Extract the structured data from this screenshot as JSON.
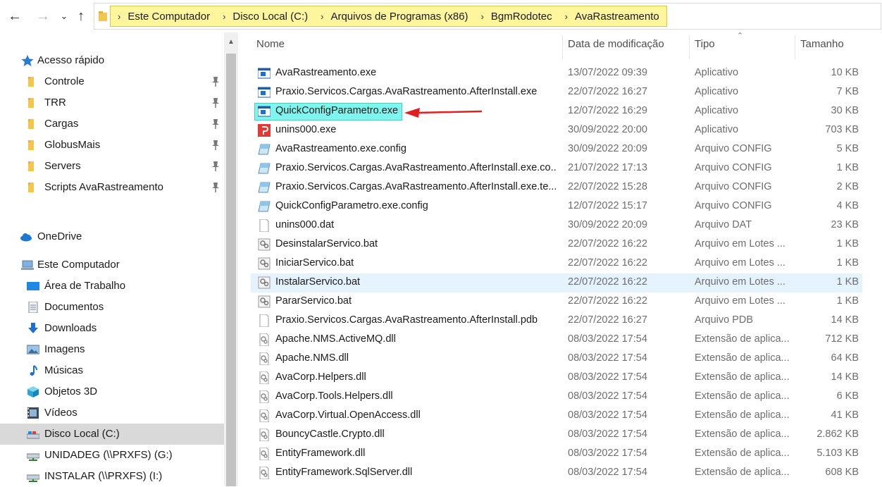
{
  "breadcrumb": [
    "Este Computador",
    "Disco Local (C:)",
    "Arquivos de Programas (x86)",
    "BgmRodotec",
    "AvaRastreamento"
  ],
  "sidebar": {
    "quick_access": "Acesso rápido",
    "pinned": [
      "Controle",
      "TRR",
      "Cargas",
      "GlobusMais",
      "Servers",
      "Scripts AvaRastreamento"
    ],
    "onedrive": "OneDrive",
    "this_pc": "Este Computador",
    "pc_items": [
      "Área de Trabalho",
      "Documentos",
      "Downloads",
      "Imagens",
      "Músicas",
      "Objetos 3D",
      "Vídeos",
      "Disco Local (C:)",
      "UNIDADEG (\\\\PRXFS) (G:)",
      "INSTALAR (\\\\PRXFS) (I:)"
    ],
    "selected": "Disco Local (C:)"
  },
  "columns": {
    "name": "Nome",
    "date": "Data de modificação",
    "type": "Tipo",
    "size": "Tamanho"
  },
  "files": [
    {
      "name": "AvaRastreamento.exe",
      "date": "13/07/2022 09:39",
      "type": "Aplicativo",
      "size": "10 KB",
      "icon": "app-icon"
    },
    {
      "name": "Praxio.Servicos.Cargas.AvaRastreamento.AfterInstall.exe",
      "date": "22/07/2022 16:27",
      "type": "Aplicativo",
      "size": "7 KB",
      "icon": "app-icon"
    },
    {
      "name": "QuickConfigParametro.exe",
      "date": "12/07/2022 16:29",
      "type": "Aplicativo",
      "size": "30 KB",
      "icon": "app-icon"
    },
    {
      "name": "unins000.exe",
      "date": "30/09/2022 20:00",
      "type": "Aplicativo",
      "size": "703 KB",
      "icon": "uninstaller-icon"
    },
    {
      "name": "AvaRastreamento.exe.config",
      "date": "30/09/2022 20:09",
      "type": "Arquivo CONFIG",
      "size": "5 KB",
      "icon": "config-icon"
    },
    {
      "name": "Praxio.Servicos.Cargas.AvaRastreamento.AfterInstall.exe.co...",
      "date": "21/07/2022 17:13",
      "type": "Arquivo CONFIG",
      "size": "1 KB",
      "icon": "config-icon"
    },
    {
      "name": "Praxio.Servicos.Cargas.AvaRastreamento.AfterInstall.exe.te...",
      "date": "22/07/2022 15:28",
      "type": "Arquivo CONFIG",
      "size": "2 KB",
      "icon": "config-icon"
    },
    {
      "name": "QuickConfigParametro.exe.config",
      "date": "12/07/2022 15:17",
      "type": "Arquivo CONFIG",
      "size": "4 KB",
      "icon": "config-icon"
    },
    {
      "name": "unins000.dat",
      "date": "30/09/2022 20:09",
      "type": "Arquivo DAT",
      "size": "23 KB",
      "icon": "blank-file-icon"
    },
    {
      "name": "DesinstalarServico.bat",
      "date": "22/07/2022 16:22",
      "type": "Arquivo em Lotes ...",
      "size": "1 KB",
      "icon": "batch-icon"
    },
    {
      "name": "IniciarServico.bat",
      "date": "22/07/2022 16:22",
      "type": "Arquivo em Lotes ...",
      "size": "1 KB",
      "icon": "batch-icon"
    },
    {
      "name": "InstalarServico.bat",
      "date": "22/07/2022 16:22",
      "type": "Arquivo em Lotes ...",
      "size": "1 KB",
      "icon": "batch-icon"
    },
    {
      "name": "PararServico.bat",
      "date": "22/07/2022 16:22",
      "type": "Arquivo em Lotes ...",
      "size": "1 KB",
      "icon": "batch-icon"
    },
    {
      "name": "Praxio.Servicos.Cargas.AvaRastreamento.AfterInstall.pdb",
      "date": "22/07/2022 16:27",
      "type": "Arquivo PDB",
      "size": "14 KB",
      "icon": "blank-file-icon"
    },
    {
      "name": "Apache.NMS.ActiveMQ.dll",
      "date": "08/03/2022 17:54",
      "type": "Extensão de aplica...",
      "size": "712 KB",
      "icon": "dll-icon"
    },
    {
      "name": "Apache.NMS.dll",
      "date": "08/03/2022 17:54",
      "type": "Extensão de aplica...",
      "size": "64 KB",
      "icon": "dll-icon"
    },
    {
      "name": "AvaCorp.Helpers.dll",
      "date": "08/03/2022 17:54",
      "type": "Extensão de aplica...",
      "size": "14 KB",
      "icon": "dll-icon"
    },
    {
      "name": "AvaCorp.Tools.Helpers.dll",
      "date": "08/03/2022 17:54",
      "type": "Extensão de aplica...",
      "size": "6 KB",
      "icon": "dll-icon"
    },
    {
      "name": "AvaCorp.Virtual.OpenAccess.dll",
      "date": "08/03/2022 17:54",
      "type": "Extensão de aplica...",
      "size": "41 KB",
      "icon": "dll-icon"
    },
    {
      "name": "BouncyCastle.Crypto.dll",
      "date": "08/03/2022 17:54",
      "type": "Extensão de aplica...",
      "size": "2.862 KB",
      "icon": "dll-icon"
    },
    {
      "name": "EntityFramework.dll",
      "date": "08/03/2022 17:54",
      "type": "Extensão de aplica...",
      "size": "5.103 KB",
      "icon": "dll-icon"
    },
    {
      "name": "EntityFramework.SqlServer.dll",
      "date": "08/03/2022 17:54",
      "type": "Extensão de aplica...",
      "size": "608 KB",
      "icon": "dll-icon"
    }
  ],
  "highlighted_file": "QuickConfigParametro.exe",
  "hover_file": "InstalarServico.bat"
}
